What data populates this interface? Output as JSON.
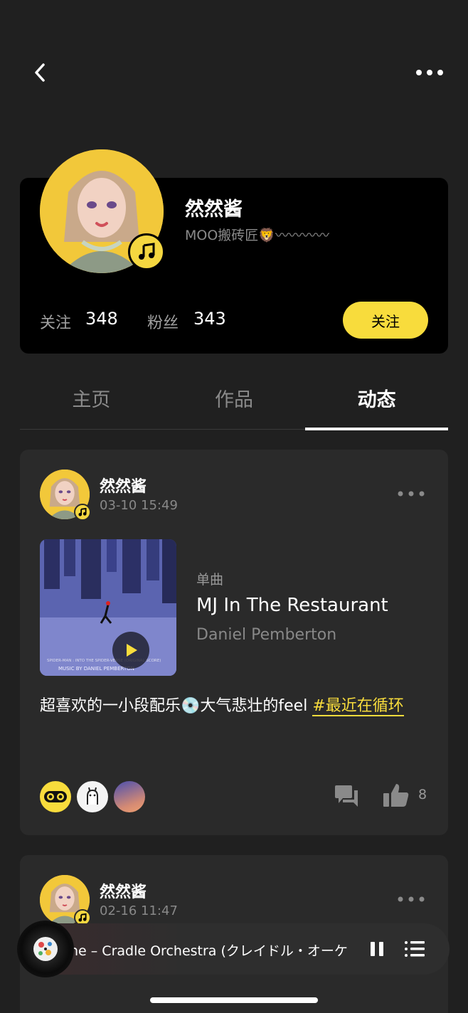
{
  "profile": {
    "name": "然然酱",
    "bio": "MOO搬砖匠🦁〰〰〰〰",
    "following_label": "关注",
    "following_count": "348",
    "fans_label": "粉丝",
    "fans_count": "343",
    "follow_button": "关注"
  },
  "tabs": [
    {
      "label": "主页",
      "active": false
    },
    {
      "label": "作品",
      "active": false
    },
    {
      "label": "动态",
      "active": true
    }
  ],
  "posts": [
    {
      "author": "然然酱",
      "time": "03-10 15:49",
      "song": {
        "type": "单曲",
        "title": "MJ In The Restaurant",
        "artist": "Daniel Pemberton",
        "cover_caption_1": "SPIDER-MAN : INTO THE SPIDER-VERSE (ORIGINAL SCORE)",
        "cover_caption_2": "MUSIC BY DANIEL PEMBERTON"
      },
      "text": "超喜欢的一小段配乐💿大气悲壮的feel ",
      "tag": "#最近在循环",
      "like_count": "8"
    },
    {
      "author": "然然酱",
      "time": "02-16 11:47"
    }
  ],
  "player": {
    "now_playing": "ne – Cradle Orchestra (クレイドル・オーケ"
  },
  "colors": {
    "accent": "#f8dc3c",
    "background": "#202020",
    "card": "#2a2a2a"
  },
  "icons": {
    "back": "chevron-left-icon",
    "more": "more-dots-icon",
    "music_badge": "music-note-icon",
    "play": "play-icon",
    "comment": "comment-icon",
    "like": "thumbs-up-icon",
    "pause": "pause-icon",
    "playlist": "playlist-icon"
  }
}
